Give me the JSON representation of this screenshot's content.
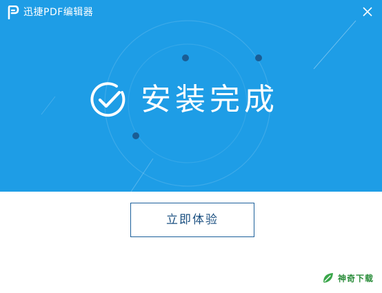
{
  "window": {
    "title": "迅捷PDF编辑器"
  },
  "hero": {
    "status_text": "安装完成"
  },
  "actions": {
    "start_label": "立即体验"
  },
  "watermark": {
    "text": "神奇下载"
  },
  "colors": {
    "banner": "#1e9de6",
    "button_border": "#1b5f9a",
    "button_text": "#1a4f80",
    "watermark": "#2a8c3a"
  },
  "icons": {
    "app": "pdf-logo-icon",
    "close": "close-icon",
    "status": "check-circle-icon",
    "watermark": "leaf-icon"
  }
}
